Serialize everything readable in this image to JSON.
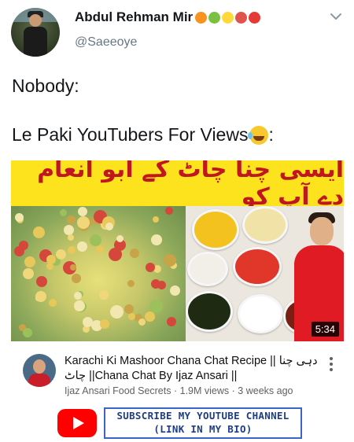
{
  "tweet": {
    "display_name": "Abdul Rehman Mir",
    "name_emojis": [
      {
        "icon": "orange-emoji",
        "color": "#f7931e"
      },
      {
        "icon": "green-apple-emoji",
        "color": "#7ac142"
      },
      {
        "icon": "lemon-emoji",
        "color": "#ffd93b"
      },
      {
        "icon": "mushroom-emoji",
        "color": "#e0544b"
      },
      {
        "icon": "tomato-emoji",
        "color": "#e53935"
      }
    ],
    "handle": "@Saeeoye",
    "text_line1": "Nobody:",
    "text_line2": "Le Paki YouTubers For Views",
    "text_line2_suffix": ":",
    "laugh_icon": "tears-of-joy-emoji"
  },
  "video": {
    "banner_text": "ایسی چنا چاٹ کے ابو انعام دے آپ کو",
    "banner_color": "#fce31d",
    "banner_text_color": "#c0161f",
    "duration": "5:34",
    "title_line1": "Karachi Ki Mashoor Chana Chat Recipe || دہی چنا",
    "title_line2": "چاٹ ||Chana Chat By Ijaz Ansari ||",
    "channel": "Ijaz Ansari Food Secrets",
    "views": "1.9M views",
    "age": "3 weeks ago",
    "separator": "·"
  },
  "promo": {
    "line1": "SUBSCRIBE MY YOUTUBE CHANNEL",
    "line2": "(LINK IN MY BIO)",
    "youtube_color": "#ff0000"
  }
}
